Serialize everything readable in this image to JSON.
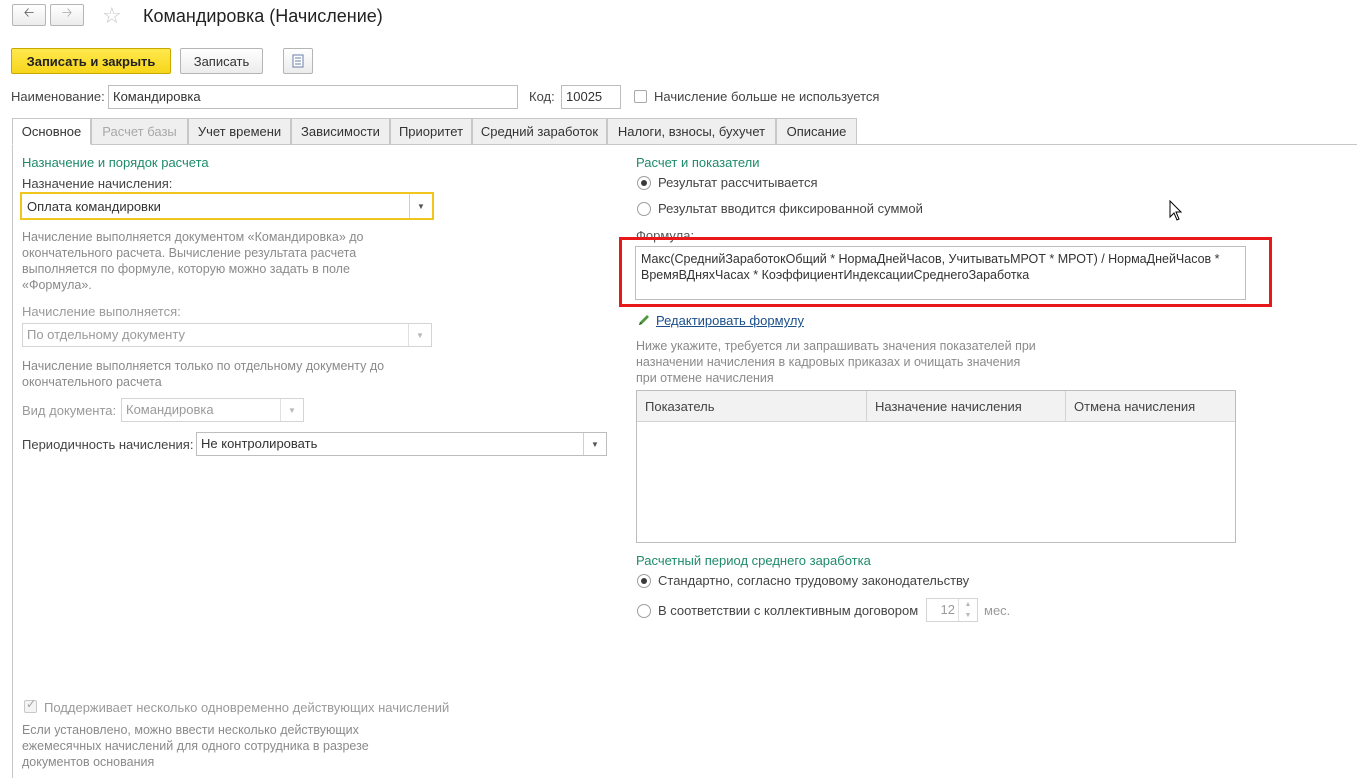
{
  "window": {
    "title": "Командировка (Начисление)"
  },
  "nav": {
    "back_icon": "arrow-left-icon",
    "forward_icon": "arrow-right-icon",
    "favorite_icon": "star-icon"
  },
  "toolbar": {
    "save_close_label": "Записать и закрыть",
    "save_label": "Записать",
    "more_icon": "list-icon"
  },
  "header": {
    "name_label": "Наименование:",
    "name_value": "Командировка",
    "code_label": "Код:",
    "code_value": "10025",
    "not_used_label": "Начисление больше не используется"
  },
  "tabs": [
    {
      "label": "Основное"
    },
    {
      "label": "Расчет базы"
    },
    {
      "label": "Учет времени"
    },
    {
      "label": "Зависимости"
    },
    {
      "label": "Приоритет"
    },
    {
      "label": "Средний заработок"
    },
    {
      "label": "Налоги, взносы, бухучет"
    },
    {
      "label": "Описание"
    }
  ],
  "left": {
    "section_title": "Назначение и порядок расчета",
    "purpose_label": "Назначение начисления:",
    "purpose_value": "Оплата командировки",
    "purpose_note": "Начисление выполняется документом «Командировка» до окончательного расчета. Вычисление результата расчета выполняется по формуле, которую можно задать в поле «Формула».",
    "performed_label": "Начисление выполняется:",
    "performed_value": "По отдельному документу",
    "performed_note": "Начисление выполняется только по отдельному документу до окончательного расчета",
    "doc_type_label": "Вид документа:",
    "doc_type_value": "Командировка",
    "periodicity_label": "Периодичность начисления:",
    "periodicity_value": "Не контролировать",
    "multi_label": "Поддерживает несколько одновременно действующих начислений",
    "multi_note": "Если установлено, можно ввести несколько действующих ежемесячных начислений для одного сотрудника в разрезе документов основания"
  },
  "right": {
    "section_title": "Расчет и показатели",
    "radio_calculated": "Результат рассчитывается",
    "radio_fixed": "Результат вводится фиксированной суммой",
    "formula_label": "Формула:",
    "formula_value": "Макс(СреднийЗаработокОбщий * НормаДнейЧасов, УчитыватьМРОТ * МРОТ) / НормаДнейЧасов * ВремяВДняхЧасах * КоэффициентИндексацииСреднегоЗаработка",
    "edit_formula_link": "Редактировать формулу",
    "indicators_note": "Ниже укажите, требуется ли запрашивать значения показателей при назначении начисления в кадровых приказах и очищать значения при отмене начисления",
    "table_headers": [
      "Показатель",
      "Назначение начисления",
      "Отмена начисления"
    ],
    "avg_section_title": "Расчетный период среднего заработка",
    "radio_standard": "Стандартно, согласно трудовому законодательству",
    "radio_collective": "В соответствии с коллективным договором",
    "months_value": "12",
    "months_unit": "мес."
  },
  "colors": {
    "accent_green": "#1e8a6a",
    "highlight_red": "#e8191b",
    "primary_yellow": "#f7d51a",
    "focus_yellow": "#f0c61c"
  }
}
